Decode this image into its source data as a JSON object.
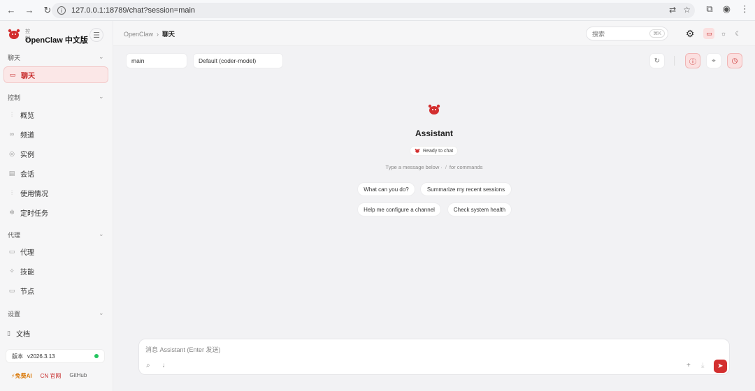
{
  "browser": {
    "url": "127.0.0.1:18789/chat?session=main",
    "back": "←",
    "forward": "→",
    "reload": "↻",
    "info": "i",
    "translate": "⇄",
    "star": "☆",
    "extensions": "⧉",
    "profile": "◉",
    "menu": "⋮"
  },
  "brand": {
    "subtitle": "控制",
    "name": "OpenClaw 中文版",
    "menu_icon": "☰"
  },
  "sidebar": {
    "sections": [
      {
        "label": "聊天",
        "chev": "⌄"
      },
      {
        "label": "控制",
        "chev": "⌄"
      },
      {
        "label": "代理",
        "chev": "⌄"
      },
      {
        "label": "设置",
        "chev": "⌄"
      }
    ],
    "items": [
      {
        "label": "聊天",
        "icon": "▭"
      },
      {
        "label": "概览",
        "icon": "⫶"
      },
      {
        "label": "频道",
        "icon": "∞"
      },
      {
        "label": "实例",
        "icon": "◎"
      },
      {
        "label": "会话",
        "icon": "▤"
      },
      {
        "label": "使用情况",
        "icon": "⫶"
      },
      {
        "label": "定时任务",
        "icon": "✲"
      },
      {
        "label": "代理",
        "icon": "▭"
      },
      {
        "label": "技能",
        "icon": "✧"
      },
      {
        "label": "节点",
        "icon": "▭"
      }
    ],
    "docs": {
      "label": "文档",
      "icon": "▯"
    },
    "version": {
      "label": "版本",
      "value": "v2026.3.13"
    },
    "links": {
      "free": "⚡免费AI",
      "site": "CN 官网",
      "github": "GitHub"
    }
  },
  "topbar": {
    "breadcrumb_root": "OpenClaw",
    "breadcrumb_sep": "›",
    "breadcrumb_current": "聊天",
    "search_placeholder": "搜索",
    "search_shortcut": "⌘K",
    "gear_icon": "⚙",
    "theme": {
      "monitor": "▭",
      "sun": "☼",
      "moon": "☾"
    }
  },
  "toolbar": {
    "session": "main",
    "model": "Default (coder-model)",
    "refresh": "↻",
    "thinking": "ⓘ",
    "focus": "⌖",
    "clock": "◷"
  },
  "welcome": {
    "title": "Assistant",
    "status": "Ready to chat",
    "hint_left": "Type a message below ·",
    "hint_key": "/",
    "hint_right": "for commands",
    "suggestions": [
      "What can you do?",
      "Summarize my recent sessions",
      "Help me configure a channel",
      "Check system health"
    ]
  },
  "composer": {
    "placeholder": "消息 Assistant (Enter 发送)",
    "attach": "⌕",
    "mic": "♩",
    "plus": "+",
    "download": "⤓",
    "send": "➤"
  },
  "colors": {
    "accent": "#d32f2f",
    "status_online": "#22c55e"
  }
}
